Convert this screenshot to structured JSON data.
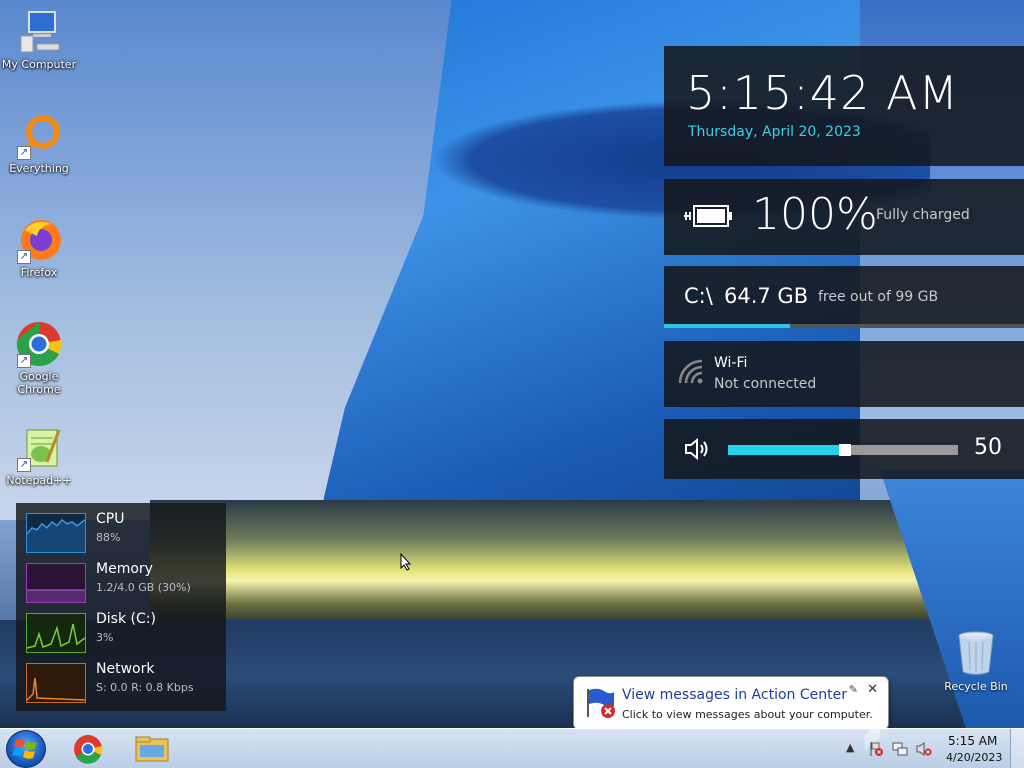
{
  "desktop": {
    "icons": [
      {
        "label": "My Computer",
        "icon": "computer-icon"
      },
      {
        "label": "Everything",
        "icon": "everything-icon"
      },
      {
        "label": "Firefox",
        "icon": "firefox-icon"
      },
      {
        "label": "Google Chrome",
        "icon": "chrome-icon"
      },
      {
        "label": "Notepad++",
        "icon": "notepad-plus-plus-icon"
      }
    ],
    "recycle_bin": {
      "label": "Recycle Bin",
      "icon": "recycle-bin-icon"
    }
  },
  "widgets": {
    "clock": {
      "time": "5:15:42 AM",
      "date": "Thursday, April 20, 2023"
    },
    "battery": {
      "percent": "100%",
      "status": "Fully charged",
      "icon": "battery-charging-icon"
    },
    "disk": {
      "drive": "C:\\",
      "free": "64.7 GB",
      "of_text": "free out of 99 GB",
      "used_fraction": 0.35
    },
    "wifi": {
      "name": "Wi-Fi",
      "status": "Not connected",
      "icon": "wifi-icon"
    },
    "volume": {
      "value": "50",
      "level": 0.5,
      "icon": "speaker-icon"
    }
  },
  "performance": {
    "rows": [
      {
        "name": "CPU",
        "value": "88%",
        "color": "#2b8fd8"
      },
      {
        "name": "Memory",
        "value": "1.2/4.0 GB (30%)",
        "color": "#9a3fb8"
      },
      {
        "name": "Disk (C:)",
        "value": "3%",
        "color": "#5aa82a"
      },
      {
        "name": "Network",
        "value": "S: 0.0  R: 0.8 Kbps",
        "color": "#c76a1a"
      }
    ]
  },
  "notification": {
    "title": "View messages in Action Center",
    "body": "Click to view messages about your computer.",
    "icon": "action-center-flag-icon"
  },
  "taskbar": {
    "start": "windows-start-icon",
    "pinned": [
      "chrome-icon",
      "file-explorer-icon"
    ],
    "tray": {
      "time": "5:15 AM",
      "date": "4/20/2023"
    }
  },
  "colors": {
    "accent": "#2fc4e0",
    "date_text": "#3ad0e8",
    "widget_bg": "#14181e"
  }
}
